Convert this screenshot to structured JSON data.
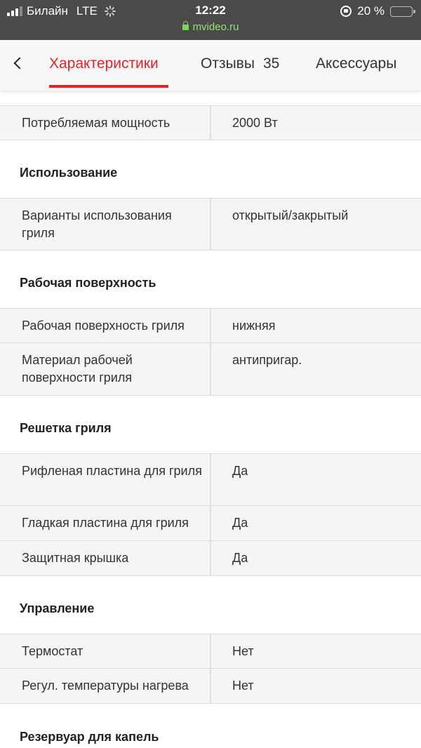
{
  "status_bar": {
    "carrier": "Билайн",
    "network": "LTE",
    "time": "12:22",
    "url": "mvideo.ru",
    "battery": "20 %",
    "battery_level": 0.2
  },
  "tabs": [
    {
      "label": "Характеристики",
      "active": true
    },
    {
      "label": "Отзывы",
      "count": "35",
      "active": false
    },
    {
      "label": "Аксессуары",
      "active": false
    }
  ],
  "specs": {
    "power_row": {
      "label": "Потребляемая мощность",
      "value": "2000 Вт"
    },
    "usage": {
      "title": "Использование",
      "rows": [
        {
          "label": "Варианты использования гриля",
          "value": "открытый/закрытый"
        }
      ]
    },
    "surface": {
      "title": "Рабочая поверхность",
      "rows": [
        {
          "label": "Рабочая поверхность гриля",
          "value": "нижняя"
        },
        {
          "label": "Материал рабочей поверхности гриля",
          "value": "антипригар."
        }
      ]
    },
    "grate": {
      "title": "Решетка гриля",
      "rows": [
        {
          "label": "Рифленая пластина для гриля",
          "value": "Да"
        },
        {
          "label": "Гладкая пластина для гриля",
          "value": "Да"
        },
        {
          "label": "Защитная крышка",
          "value": "Да"
        }
      ]
    },
    "control": {
      "title": "Управление",
      "rows": [
        {
          "label": "Термостат",
          "value": "Нет"
        },
        {
          "label": "Регул. температуры нагрева",
          "value": "Нет"
        }
      ]
    },
    "drip": {
      "title": "Резервуар для капель"
    }
  },
  "colors": {
    "accent": "#e0252b",
    "status_bg": "#4a4a4a",
    "url_green": "#9be07a"
  },
  "icons": [
    "signal-icon",
    "loading-spinner-icon",
    "lock-icon",
    "rotation-lock-icon",
    "battery-icon",
    "back-chevron-icon"
  ]
}
